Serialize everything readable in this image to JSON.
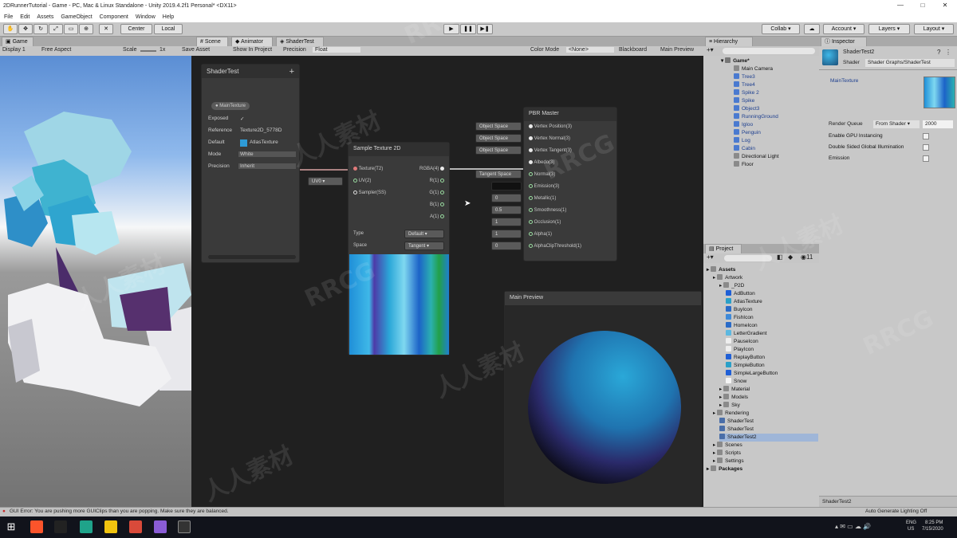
{
  "window": {
    "title": "2DRunnerTutorial - Game - PC, Mac & Linux Standalone - Unity 2019.4.2f1 Personal* <DX11>",
    "min": "—",
    "max": "□",
    "close": "✕"
  },
  "menu": [
    "File",
    "Edit",
    "Assets",
    "GameObject",
    "Component",
    "Window",
    "Help"
  ],
  "toolbar": {
    "center": "Center",
    "local": "Local",
    "collab": "Collab ▾",
    "account": "Account ▾",
    "layers": "Layers ▾",
    "layout": "Layout ▾"
  },
  "game": {
    "tab": "Game",
    "display": "Display 1",
    "aspect": "Free Aspect",
    "scale_label": "Scale",
    "scale_value": "1x"
  },
  "shader_graph": {
    "tabs": [
      "Scene",
      "Animator",
      "ShaderTest"
    ],
    "toolbar": {
      "save": "Save Asset",
      "show": "Show In Project",
      "precision_label": "Precision",
      "precision": "Float",
      "color_mode_label": "Color Mode",
      "color_mode": "<None>",
      "blackboard": "Blackboard",
      "main_preview": "Main Preview"
    },
    "blackboard": {
      "title": "ShaderTest",
      "property": "MainTexture",
      "rows": [
        {
          "label": "Exposed",
          "value": "✓"
        },
        {
          "label": "Reference",
          "value": "Texture2D_5778D"
        },
        {
          "label": "Default",
          "value": "AtlasTexture"
        },
        {
          "label": "Mode",
          "value": "White"
        },
        {
          "label": "Precision",
          "value": "Inherit"
        }
      ]
    },
    "sample_node": {
      "title": "Sample Texture 2D",
      "inputs": [
        "Texture(T2)",
        "UV(2)",
        "Sampler(SS)"
      ],
      "outputs": [
        "RGBA(4)",
        "R(1)",
        "G(1)",
        "B(1)",
        "A(1)"
      ],
      "type_label": "Type",
      "type_value": "Default",
      "space_label": "Space",
      "space_value": "Tangent",
      "uv_chip": "UV0"
    },
    "master_node": {
      "title": "PBR Master",
      "ports": [
        "Vertex Position(3)",
        "Vertex Normal(3)",
        "Vertex Tangent(3)",
        "Albedo(3)",
        "Normal(3)",
        "Emission(3)",
        "Metallic(1)",
        "Smoothness(1)",
        "Occlusion(1)",
        "Alpha(1)",
        "AlphaClipThreshold(1)"
      ],
      "chips": [
        "Object Space",
        "Object Space",
        "Object Space",
        "",
        "Tangent Space",
        "",
        "0",
        "0.5",
        "1",
        "1",
        "0"
      ]
    },
    "main_preview_title": "Main Preview"
  },
  "hierarchy": {
    "tab": "Hierarchy",
    "scene": "Game*",
    "items": [
      {
        "name": "Main Camera",
        "blue": false
      },
      {
        "name": "Tree3",
        "blue": true
      },
      {
        "name": "Tree4",
        "blue": true
      },
      {
        "name": "Spike 2",
        "blue": true
      },
      {
        "name": "Spike",
        "blue": true
      },
      {
        "name": "Object3",
        "blue": true
      },
      {
        "name": "RunningGround",
        "blue": true
      },
      {
        "name": "Igloo",
        "blue": true
      },
      {
        "name": "Penguin",
        "blue": true
      },
      {
        "name": "Log",
        "blue": true
      },
      {
        "name": "Cabin",
        "blue": true
      },
      {
        "name": "Directional Light",
        "blue": false
      },
      {
        "name": "Floor",
        "blue": false
      }
    ]
  },
  "project": {
    "tab": "Project",
    "count": "11",
    "items": [
      {
        "name": "Assets",
        "depth": 0,
        "bold": true,
        "folder": true
      },
      {
        "name": "Artwork",
        "depth": 1,
        "folder": true
      },
      {
        "name": "_P2D",
        "depth": 2,
        "folder": true
      },
      {
        "name": "AdButton",
        "depth": 3,
        "color": "#1f5fd6"
      },
      {
        "name": "AtlasTexture",
        "depth": 3,
        "color": "#2aa0c8"
      },
      {
        "name": "BuyIcon",
        "depth": 3,
        "color": "#2a6bc8"
      },
      {
        "name": "FishIcon",
        "depth": 3,
        "color": "#3f8ad9"
      },
      {
        "name": "HomeIcon",
        "depth": 3,
        "color": "#2a6bc8"
      },
      {
        "name": "LetterGradient",
        "depth": 3,
        "color": "#5cb8e0"
      },
      {
        "name": "PauseIcon",
        "depth": 3,
        "color": "#eeeeee"
      },
      {
        "name": "PlayIcon",
        "depth": 3,
        "color": "#eeeeee"
      },
      {
        "name": "ReplayButton",
        "depth": 3,
        "color": "#1f5fd6"
      },
      {
        "name": "SimpleButton",
        "depth": 3,
        "color": "#2aa0c8"
      },
      {
        "name": "SimpleLargeButton",
        "depth": 3,
        "color": "#1f5fd6"
      },
      {
        "name": "Snow",
        "depth": 3,
        "color": "#f4f4f4"
      },
      {
        "name": "Material",
        "depth": 2,
        "folder": true
      },
      {
        "name": "Models",
        "depth": 2,
        "folder": true
      },
      {
        "name": "Sky",
        "depth": 2,
        "folder": true
      },
      {
        "name": "Rendering",
        "depth": 1,
        "folder": true
      },
      {
        "name": "ShaderTest",
        "depth": 2,
        "color": "#4a6ea8"
      },
      {
        "name": "ShaderTest",
        "depth": 2,
        "color": "#4a6ea8"
      },
      {
        "name": "ShaderTest2",
        "depth": 2,
        "color": "#4a6ea8",
        "selected": true
      },
      {
        "name": "Scenes",
        "depth": 1,
        "folder": true
      },
      {
        "name": "Scripts",
        "depth": 1,
        "folder": true
      },
      {
        "name": "Settings",
        "depth": 1,
        "folder": true
      },
      {
        "name": "Packages",
        "depth": 0,
        "bold": true,
        "folder": true
      }
    ]
  },
  "inspector": {
    "tab": "Inspector",
    "asset_name": "ShaderTest2",
    "shader_label": "Shader",
    "shader_value": "Shader Graphs/ShaderTest",
    "texture_prop": "MainTexture",
    "render_queue_label": "Render Queue",
    "render_queue_mode": "From Shader",
    "render_queue_value": "2000",
    "options": [
      "Enable GPU Instancing",
      "Double Sided Global Illumination",
      "Emission"
    ],
    "footer_name": "ShaderTest2"
  },
  "status": {
    "message": "GUI Error: You are pushing more GUIClips than you are popping. Make sure they are balanced.",
    "right": "Auto Generate Lighting Off"
  },
  "taskbar": {
    "lang": "ENG",
    "region": "US",
    "time": "8:25 PM",
    "date": "7/15/2020",
    "colors": {
      "brave": "#fb542b",
      "terminal": "#222222",
      "unity": "#1fa38a",
      "explorer": "#f1c40f",
      "vs": "#8a5cd6",
      "unityhub": "#333333"
    }
  },
  "watermark": [
    "RRCG",
    "人人素材"
  ]
}
